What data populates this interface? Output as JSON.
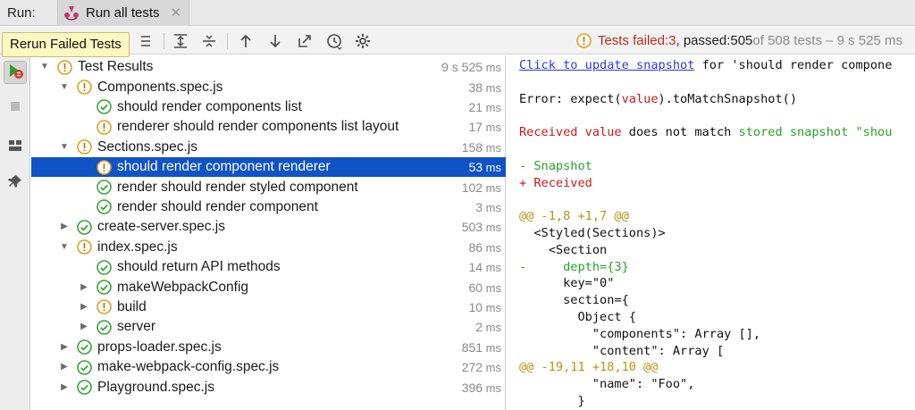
{
  "tabbar": {
    "run_label": "Run:",
    "tab_title": "Run all tests",
    "close_glyph": "✕"
  },
  "tooltip": {
    "text": "Rerun Failed Tests"
  },
  "status": {
    "prefix": "Tests failed: ",
    "failed": "3",
    "sep": ", passed: ",
    "passed": "505",
    "suffix": " of 508 tests – 9 s 525 ms"
  },
  "colors": {
    "selected": "#0f53c7",
    "pass": "#3aa33a",
    "fail": "#e0a020",
    "error_text": "#c02a1b"
  },
  "toolbar_icons": [
    "rerun-icon",
    "stop-icon",
    "toggle-passed-icon",
    "sort-icon",
    "expand-all-icon",
    "collapse-all-icon",
    "previous-failed-icon",
    "next-failed-icon",
    "export-icon",
    "history-icon",
    "settings-icon"
  ],
  "side_icons": [
    "rerun-failed-icon",
    "stop-icon",
    "layout-icon",
    "pin-icon"
  ],
  "tree": [
    {
      "depth": 0,
      "arrow": "down",
      "status": "fail",
      "label": "Test Results",
      "dur": "9 s 525",
      "unit": "ms"
    },
    {
      "depth": 1,
      "arrow": "down",
      "status": "fail",
      "label": "Components.spec.js",
      "dur": "38",
      "unit": "ms"
    },
    {
      "depth": 2,
      "arrow": "",
      "status": "pass",
      "label": "should render components list",
      "dur": "21",
      "unit": "ms"
    },
    {
      "depth": 2,
      "arrow": "",
      "status": "fail",
      "label": "renderer should render components list layout",
      "dur": "17",
      "unit": "ms"
    },
    {
      "depth": 1,
      "arrow": "down",
      "status": "fail",
      "label": "Sections.spec.js",
      "dur": "158",
      "unit": "ms"
    },
    {
      "depth": 2,
      "arrow": "",
      "status": "fail",
      "label": "should render component renderer",
      "dur": "53",
      "unit": "ms",
      "selected": true
    },
    {
      "depth": 2,
      "arrow": "",
      "status": "pass",
      "label": "render should render styled component",
      "dur": "102",
      "unit": "ms"
    },
    {
      "depth": 2,
      "arrow": "",
      "status": "pass",
      "label": "render should render component",
      "dur": "3",
      "unit": "ms"
    },
    {
      "depth": 1,
      "arrow": "right",
      "status": "pass",
      "label": "create-server.spec.js",
      "dur": "503",
      "unit": "ms"
    },
    {
      "depth": 1,
      "arrow": "down",
      "status": "fail",
      "label": "index.spec.js",
      "dur": "86",
      "unit": "ms"
    },
    {
      "depth": 2,
      "arrow": "",
      "status": "pass",
      "label": "should return API methods",
      "dur": "14",
      "unit": "ms"
    },
    {
      "depth": 2,
      "arrow": "right",
      "status": "pass",
      "label": "makeWebpackConfig",
      "dur": "60",
      "unit": "ms"
    },
    {
      "depth": 2,
      "arrow": "right",
      "status": "fail",
      "label": "build",
      "dur": "10",
      "unit": "ms"
    },
    {
      "depth": 2,
      "arrow": "right",
      "status": "pass",
      "label": "server",
      "dur": "2",
      "unit": "ms"
    },
    {
      "depth": 1,
      "arrow": "right",
      "status": "pass",
      "label": "props-loader.spec.js",
      "dur": "851",
      "unit": "ms"
    },
    {
      "depth": 1,
      "arrow": "right",
      "status": "pass",
      "label": "make-webpack-config.spec.js",
      "dur": "272",
      "unit": "ms"
    },
    {
      "depth": 1,
      "arrow": "right",
      "status": "pass",
      "label": "Playground.spec.js",
      "dur": "396",
      "unit": "ms"
    }
  ],
  "console": [
    [
      {
        "t": "Click to update snapshot",
        "c": "link"
      },
      {
        "t": " for 'should render compone",
        "c": ""
      }
    ],
    [],
    [
      {
        "t": "Error: expect(",
        "c": ""
      },
      {
        "t": "value",
        "c": "red"
      },
      {
        "t": ").toMatchSnapshot()",
        "c": ""
      }
    ],
    [],
    [
      {
        "t": "Received value",
        "c": "red"
      },
      {
        "t": " does not match ",
        "c": ""
      },
      {
        "t": "stored snapshot \"shou",
        "c": "green"
      }
    ],
    [],
    [
      {
        "t": "- Snapshot",
        "c": "green"
      }
    ],
    [
      {
        "t": "+ Received",
        "c": "red"
      }
    ],
    [],
    [
      {
        "t": "@@ -1,8 +1,7 @@",
        "c": "gold"
      }
    ],
    [
      {
        "t": "  <Styled(Sections)>",
        "c": ""
      }
    ],
    [
      {
        "t": "    <Section",
        "c": ""
      }
    ],
    [
      {
        "t": "-     depth={3}",
        "c": "green"
      }
    ],
    [
      {
        "t": "      key=\"0\"",
        "c": ""
      }
    ],
    [
      {
        "t": "      section={",
        "c": ""
      }
    ],
    [
      {
        "t": "        Object {",
        "c": ""
      }
    ],
    [
      {
        "t": "          \"components\": Array [],",
        "c": ""
      }
    ],
    [
      {
        "t": "          \"content\": Array [",
        "c": ""
      }
    ],
    [
      {
        "t": "@@ -19,11 +18,10 @@",
        "c": "gold"
      }
    ],
    [
      {
        "t": "          \"name\": \"Foo\",",
        "c": ""
      }
    ],
    [
      {
        "t": "        }",
        "c": ""
      }
    ]
  ]
}
